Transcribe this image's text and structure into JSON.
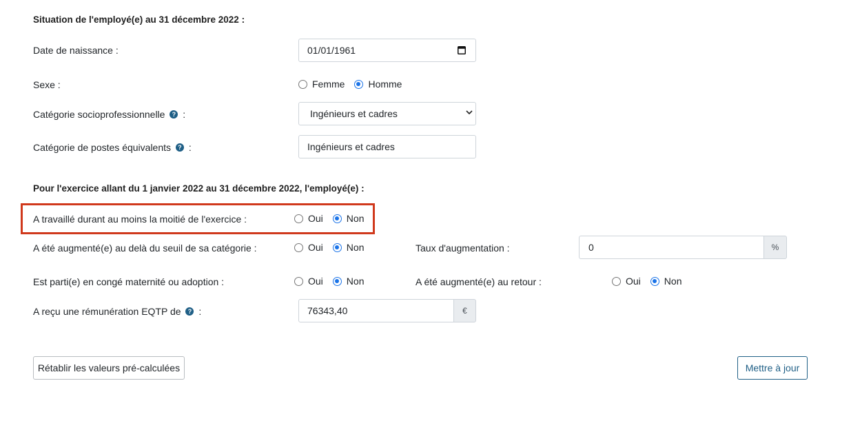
{
  "section1": {
    "heading": "Situation de l'employé(e) au 31 décembre 2022 :",
    "birthdate": {
      "label": "Date de naissance :",
      "value": "01/01/1961"
    },
    "sex": {
      "label": "Sexe :",
      "options": [
        "Femme",
        "Homme"
      ],
      "selected": "Homme"
    },
    "csp": {
      "label": "Catégorie socioprofessionnelle",
      "suffix": ":",
      "value": "Ingénieurs et cadres"
    },
    "poste": {
      "label": "Catégorie de postes équivalents",
      "suffix": ":",
      "value": "Ingénieurs et cadres"
    }
  },
  "section2": {
    "heading": "Pour l'exercice allant du 1 janvier 2022 au 31 décembre 2022, l'employé(e) :",
    "worked_half": {
      "label": "A travaillé durant au moins la moitié de l'exercice :",
      "options": [
        "Oui",
        "Non"
      ],
      "selected": "Non"
    },
    "raised": {
      "label": "A été augmenté(e) au delà du seuil de sa catégorie :",
      "options": [
        "Oui",
        "Non"
      ],
      "selected": "Non"
    },
    "raise_rate": {
      "label": "Taux d'augmentation :",
      "value": "0",
      "unit": "%"
    },
    "maternity": {
      "label": "Est parti(e) en congé maternité ou adoption :",
      "options": [
        "Oui",
        "Non"
      ],
      "selected": "Non"
    },
    "raised_return": {
      "label": "A été augmenté(e) au retour :",
      "options": [
        "Oui",
        "Non"
      ],
      "selected": "Non"
    },
    "eqtp": {
      "label": "A reçu une rémunération EQTP de",
      "suffix": ":",
      "value": "76343,40",
      "unit": "€"
    }
  },
  "buttons": {
    "reset": "Rétablir les valeurs pré-calculées",
    "update": "Mettre à jour"
  },
  "help_icon_glyph": "?",
  "colors": {
    "accent": "#1f5f86",
    "radio": "#1a73e8",
    "highlight": "#d0391c"
  }
}
